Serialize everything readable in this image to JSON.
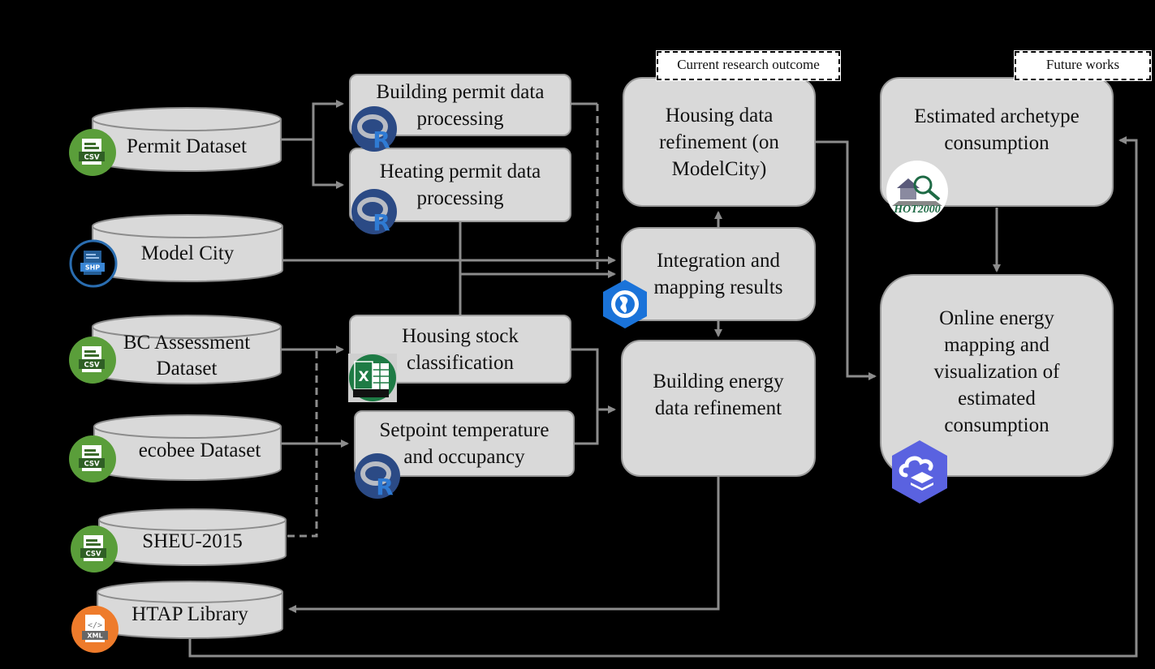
{
  "tags": {
    "current": "Current research outcome",
    "future": "Future works"
  },
  "datasets": [
    {
      "label": "Permit Dataset",
      "icon": "csv-icon"
    },
    {
      "label": "Model City",
      "icon": "shp-icon"
    },
    {
      "label": "BC Assessment Dataset",
      "icon": "csv-icon"
    },
    {
      "label": "ecobee Dataset",
      "icon": "csv-icon"
    },
    {
      "label": "SHEU-2015",
      "icon": "csv-icon"
    },
    {
      "label": "HTAP Library",
      "icon": "xml-icon"
    }
  ],
  "processes": [
    {
      "label": "Building permit data processing",
      "icon": "r-language-icon"
    },
    {
      "label": "Heating permit data processing",
      "icon": "r-language-icon"
    },
    {
      "label": "Housing stock classification",
      "icon": "excel-icon"
    },
    {
      "label": "Setpoint temperature and occupancy",
      "icon": "r-language-icon"
    }
  ],
  "outcomes": [
    {
      "label": "Housing data refinement (on ModelCity)"
    },
    {
      "label": "Integration and mapping results",
      "icon": "arcgis-globe-icon"
    },
    {
      "label": "Building energy data refinement"
    }
  ],
  "future": [
    {
      "label": "Estimated archetype consumption",
      "icon": "hot2000-icon"
    },
    {
      "label": "Online energy mapping and visualization of estimated consumption",
      "icon": "arcgis-online-cloud-icon"
    }
  ],
  "icon_text": {
    "csv": "CSV",
    "shp": "SHP",
    "xml": "XML",
    "hot2000": "HOT2000",
    "r": "R",
    "x": "X"
  },
  "colors": {
    "background": "#000000",
    "box_fill": "#d9d9d9",
    "connector": "#8c8c8c",
    "csv_green": "#5a9e3a",
    "shp_blue": "#2a6db0",
    "xml_orange": "#ee7b2b",
    "r_blue": "#2b4a85",
    "excel_green": "#1e7b45",
    "arcgis_blue": "#1a73d9",
    "arcgis_online_purple": "#5a62e0"
  }
}
